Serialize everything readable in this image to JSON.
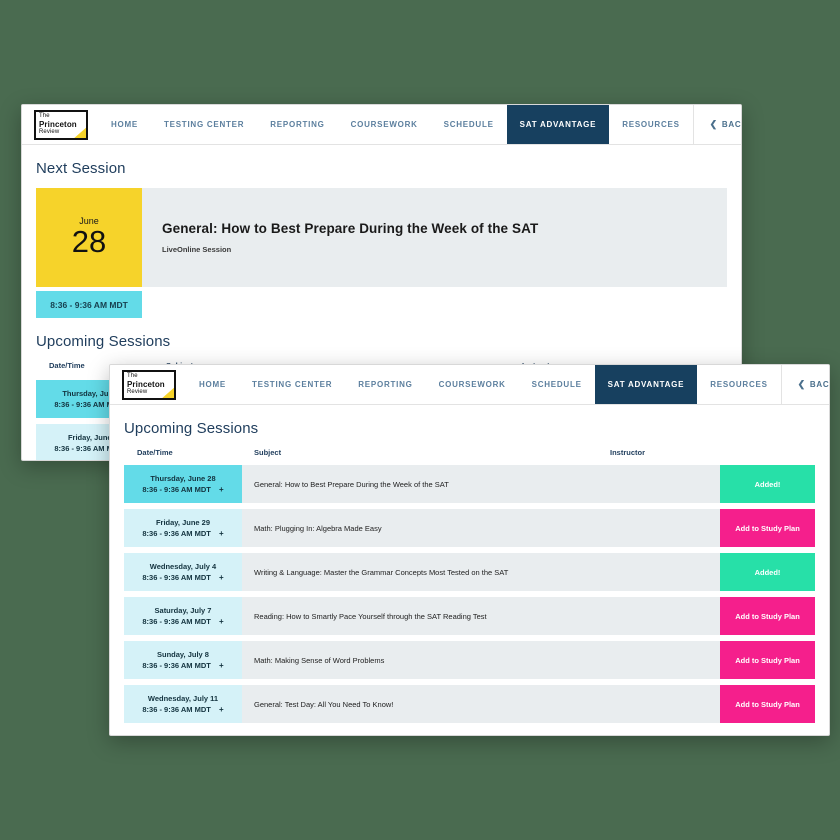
{
  "brand": {
    "logo_line1": "The",
    "logo_line2": "Princeton",
    "logo_line3": "Review",
    "accent_yellow": "#f6d32a"
  },
  "colors": {
    "background": "#4a6b50",
    "nav_active": "#17405f",
    "nav_link": "#5c7f9e",
    "heading_navy": "#1f3d5c",
    "panel_gray": "#e9edef",
    "cyan_strong": "#63dbe8",
    "cyan_light": "#d5f2f8",
    "green_added": "#27e0a8",
    "pink_add": "#f51f8c"
  },
  "nav": {
    "items": [
      {
        "label": "HOME",
        "active": false
      },
      {
        "label": "TESTING CENTER",
        "active": false
      },
      {
        "label": "REPORTING",
        "active": false
      },
      {
        "label": "COURSEWORK",
        "active": false
      },
      {
        "label": "SCHEDULE",
        "active": false
      },
      {
        "label": "SAT ADVANTAGE",
        "active": true
      },
      {
        "label": "RESOURCES",
        "active": false
      }
    ],
    "back_link": "BACK TO MY CAMPUS",
    "back_icon": "chevron-left-icon"
  },
  "back_window": {
    "next_session_heading": "Next Session",
    "next_session": {
      "month": "June",
      "day": "28",
      "title": "General: How to Best Prepare During the Week of the SAT",
      "subtitle": "LiveOnline Session",
      "time": "8:36 - 9:36 AM MDT"
    },
    "upcoming_heading": "Upcoming Sessions",
    "table_header": {
      "date": "Date/Time",
      "subject": "Subject",
      "instructor": "Instructor"
    },
    "rows": [
      {
        "date": "Thursday, June 28",
        "time": "8:36 - 9:36 AM MDT",
        "first": true
      },
      {
        "date": "Friday, June 29",
        "time": "8:36 - 9:36 AM MDT",
        "first": false
      }
    ]
  },
  "front_window": {
    "upcoming_heading": "Upcoming Sessions",
    "table_header": {
      "date": "Date/Time",
      "subject": "Subject",
      "instructor": "Instructor"
    },
    "rows": [
      {
        "date": "Thursday, June 28",
        "time": "8:36 - 9:36 AM MDT",
        "subject": "General: How to Best Prepare During the Week of the SAT",
        "instructor": "",
        "action": "Added!",
        "action_state": "added"
      },
      {
        "date": "Friday, June 29",
        "time": "8:36 - 9:36 AM MDT",
        "subject": "Math: Plugging In: Algebra Made Easy",
        "instructor": "",
        "action": "Add to Study Plan",
        "action_state": "add"
      },
      {
        "date": "Wednesday, July 4",
        "time": "8:36 - 9:36 AM MDT",
        "subject": "Writing & Language: Master the Grammar Concepts Most Tested on the SAT",
        "instructor": "",
        "action": "Added!",
        "action_state": "added"
      },
      {
        "date": "Saturday, July 7",
        "time": "8:36 - 9:36 AM MDT",
        "subject": "Reading: How to Smartly Pace Yourself through the SAT Reading Test",
        "instructor": "",
        "action": "Add to Study Plan",
        "action_state": "add"
      },
      {
        "date": "Sunday, July 8",
        "time": "8:36 - 9:36 AM MDT",
        "subject": "Math: Making Sense of Word Problems",
        "instructor": "",
        "action": "Add to Study Plan",
        "action_state": "add"
      },
      {
        "date": "Wednesday, July 11",
        "time": "8:36 - 9:36 AM MDT",
        "subject": "General: Test Day: All You Need To Know!",
        "instructor": "",
        "action": "Add to Study Plan",
        "action_state": "add"
      }
    ],
    "add_icon": "plus-icon"
  }
}
